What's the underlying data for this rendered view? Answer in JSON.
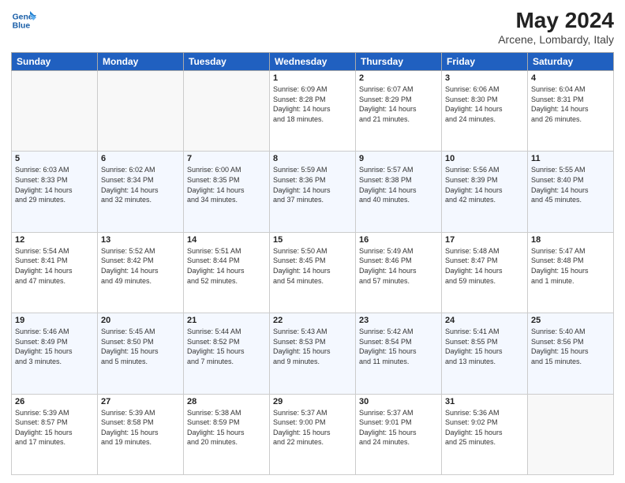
{
  "header": {
    "logo_line1": "General",
    "logo_line2": "Blue",
    "month": "May 2024",
    "location": "Arcene, Lombardy, Italy"
  },
  "days_of_week": [
    "Sunday",
    "Monday",
    "Tuesday",
    "Wednesday",
    "Thursday",
    "Friday",
    "Saturday"
  ],
  "weeks": [
    [
      {
        "day": "",
        "info": ""
      },
      {
        "day": "",
        "info": ""
      },
      {
        "day": "",
        "info": ""
      },
      {
        "day": "1",
        "info": "Sunrise: 6:09 AM\nSunset: 8:28 PM\nDaylight: 14 hours\nand 18 minutes."
      },
      {
        "day": "2",
        "info": "Sunrise: 6:07 AM\nSunset: 8:29 PM\nDaylight: 14 hours\nand 21 minutes."
      },
      {
        "day": "3",
        "info": "Sunrise: 6:06 AM\nSunset: 8:30 PM\nDaylight: 14 hours\nand 24 minutes."
      },
      {
        "day": "4",
        "info": "Sunrise: 6:04 AM\nSunset: 8:31 PM\nDaylight: 14 hours\nand 26 minutes."
      }
    ],
    [
      {
        "day": "5",
        "info": "Sunrise: 6:03 AM\nSunset: 8:33 PM\nDaylight: 14 hours\nand 29 minutes."
      },
      {
        "day": "6",
        "info": "Sunrise: 6:02 AM\nSunset: 8:34 PM\nDaylight: 14 hours\nand 32 minutes."
      },
      {
        "day": "7",
        "info": "Sunrise: 6:00 AM\nSunset: 8:35 PM\nDaylight: 14 hours\nand 34 minutes."
      },
      {
        "day": "8",
        "info": "Sunrise: 5:59 AM\nSunset: 8:36 PM\nDaylight: 14 hours\nand 37 minutes."
      },
      {
        "day": "9",
        "info": "Sunrise: 5:57 AM\nSunset: 8:38 PM\nDaylight: 14 hours\nand 40 minutes."
      },
      {
        "day": "10",
        "info": "Sunrise: 5:56 AM\nSunset: 8:39 PM\nDaylight: 14 hours\nand 42 minutes."
      },
      {
        "day": "11",
        "info": "Sunrise: 5:55 AM\nSunset: 8:40 PM\nDaylight: 14 hours\nand 45 minutes."
      }
    ],
    [
      {
        "day": "12",
        "info": "Sunrise: 5:54 AM\nSunset: 8:41 PM\nDaylight: 14 hours\nand 47 minutes."
      },
      {
        "day": "13",
        "info": "Sunrise: 5:52 AM\nSunset: 8:42 PM\nDaylight: 14 hours\nand 49 minutes."
      },
      {
        "day": "14",
        "info": "Sunrise: 5:51 AM\nSunset: 8:44 PM\nDaylight: 14 hours\nand 52 minutes."
      },
      {
        "day": "15",
        "info": "Sunrise: 5:50 AM\nSunset: 8:45 PM\nDaylight: 14 hours\nand 54 minutes."
      },
      {
        "day": "16",
        "info": "Sunrise: 5:49 AM\nSunset: 8:46 PM\nDaylight: 14 hours\nand 57 minutes."
      },
      {
        "day": "17",
        "info": "Sunrise: 5:48 AM\nSunset: 8:47 PM\nDaylight: 14 hours\nand 59 minutes."
      },
      {
        "day": "18",
        "info": "Sunrise: 5:47 AM\nSunset: 8:48 PM\nDaylight: 15 hours\nand 1 minute."
      }
    ],
    [
      {
        "day": "19",
        "info": "Sunrise: 5:46 AM\nSunset: 8:49 PM\nDaylight: 15 hours\nand 3 minutes."
      },
      {
        "day": "20",
        "info": "Sunrise: 5:45 AM\nSunset: 8:50 PM\nDaylight: 15 hours\nand 5 minutes."
      },
      {
        "day": "21",
        "info": "Sunrise: 5:44 AM\nSunset: 8:52 PM\nDaylight: 15 hours\nand 7 minutes."
      },
      {
        "day": "22",
        "info": "Sunrise: 5:43 AM\nSunset: 8:53 PM\nDaylight: 15 hours\nand 9 minutes."
      },
      {
        "day": "23",
        "info": "Sunrise: 5:42 AM\nSunset: 8:54 PM\nDaylight: 15 hours\nand 11 minutes."
      },
      {
        "day": "24",
        "info": "Sunrise: 5:41 AM\nSunset: 8:55 PM\nDaylight: 15 hours\nand 13 minutes."
      },
      {
        "day": "25",
        "info": "Sunrise: 5:40 AM\nSunset: 8:56 PM\nDaylight: 15 hours\nand 15 minutes."
      }
    ],
    [
      {
        "day": "26",
        "info": "Sunrise: 5:39 AM\nSunset: 8:57 PM\nDaylight: 15 hours\nand 17 minutes."
      },
      {
        "day": "27",
        "info": "Sunrise: 5:39 AM\nSunset: 8:58 PM\nDaylight: 15 hours\nand 19 minutes."
      },
      {
        "day": "28",
        "info": "Sunrise: 5:38 AM\nSunset: 8:59 PM\nDaylight: 15 hours\nand 20 minutes."
      },
      {
        "day": "29",
        "info": "Sunrise: 5:37 AM\nSunset: 9:00 PM\nDaylight: 15 hours\nand 22 minutes."
      },
      {
        "day": "30",
        "info": "Sunrise: 5:37 AM\nSunset: 9:01 PM\nDaylight: 15 hours\nand 24 minutes."
      },
      {
        "day": "31",
        "info": "Sunrise: 5:36 AM\nSunset: 9:02 PM\nDaylight: 15 hours\nand 25 minutes."
      },
      {
        "day": "",
        "info": ""
      }
    ]
  ]
}
